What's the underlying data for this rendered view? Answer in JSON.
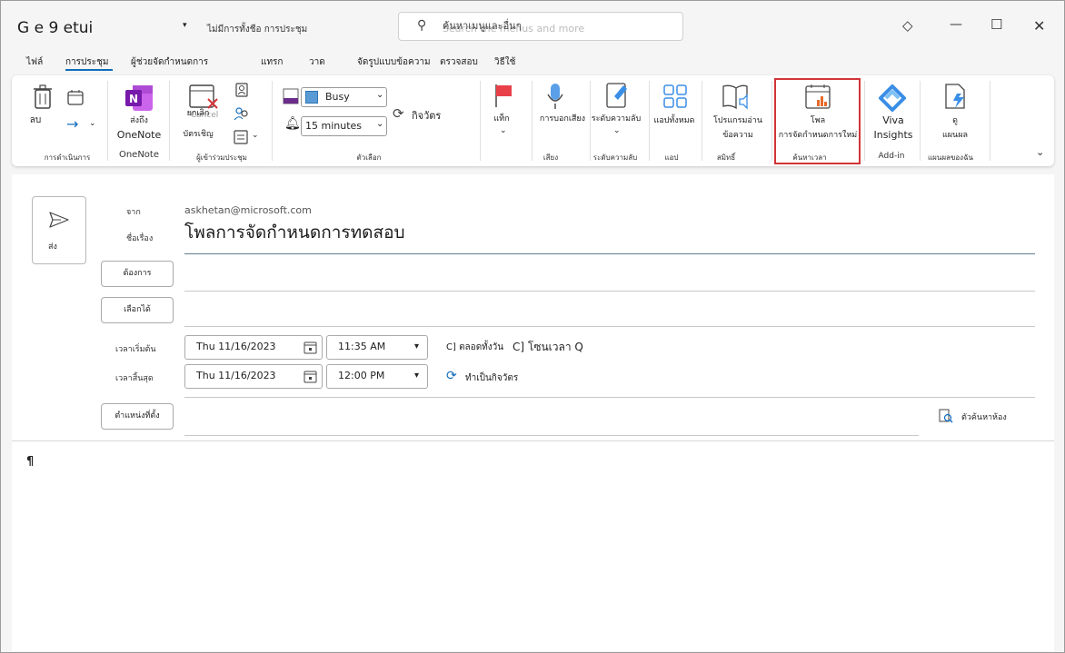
{
  "titlebar": {
    "title": "G e 9 etui",
    "quick_action": "ไม่มีการทั้งชือ การประชุม",
    "search_placeholder_th": "ค้นหาเมนูและอื่นๆ",
    "search_placeholder_en": "Search the menus and more"
  },
  "tabs": [
    "ไฟล์",
    "การประชุม",
    "ผู้ช่วยจัดกำหนดการ",
    "แทรก",
    "วาด",
    "จัดรูปแบบข้อความ",
    "ตรวจสอบ",
    "วิธีใช้"
  ],
  "ribbon": {
    "delete": "ลบ",
    "onenote_send": "ส่งถึง",
    "onenote_label": "OneNote",
    "onenote_group": "OneNote",
    "actions_group": "การดำเนินการ",
    "cancel_th": "ยกเลิก",
    "cancel_en": "Cancel",
    "cancel_inv": "บัตรเชิญ",
    "attendees_group": "ผู้เข้าร่วมประชุม",
    "busy": "Busy",
    "reminder": "15 minutes",
    "recurrence": "กิจวัตร",
    "options_group": "ตัวเลือก",
    "tags": "แท็ก",
    "dictate": "การบอกเสียง",
    "voice_group": "เสียง",
    "sensitivity": "ระดับความลับ",
    "sensitivity_group": "ระดับความลับ",
    "apps": "แอปทั้งหมด",
    "apps_group": "แอป",
    "reader": "โปรแกรมอ่านข้อความ",
    "immersive_group": "สมิทธิ์",
    "poll_1": "โพล",
    "poll_2": "การจัดกำหนดการใหม่",
    "find_time_group": "ค้นหาเวลา",
    "viva_1": "Viva",
    "viva_2": "Insights",
    "addin_group": "Add-in",
    "myday_1": "ดู",
    "myday_2": "แผนผล",
    "myday_group": "แผนผลของฉัน"
  },
  "compose": {
    "send": "ส่ง",
    "from_label": "จาก",
    "from_value": "askhetan@microsoft.com",
    "subject_label": "ชื่อเรื่อง",
    "subject_value": "โพลการจัดกำหนดการทดสอบ",
    "required": "ต้องการ",
    "optional": "เลือกได้",
    "start_label": "เวลาเริ่มต้น",
    "end_label": "เวลาสิ้นสุด",
    "start_date": "Thu 11/16/2023",
    "start_time": "11:35 AM",
    "end_date": "Thu 11/16/2023",
    "end_time": "12:00 PM",
    "allday": "C] ตลอดทั้งวัน",
    "timezone": "C] โซนเวลา Q",
    "recurring": "ทำเป็นกิจวัตร",
    "location": "ตำแหน่งที่ตั้ง",
    "room_finder": "ตัวค้นหาห้อง",
    "body": "¶"
  },
  "colors": {
    "accent": "#0f6cbd",
    "highlight": "#d13438",
    "onenote": "#7719aa"
  }
}
